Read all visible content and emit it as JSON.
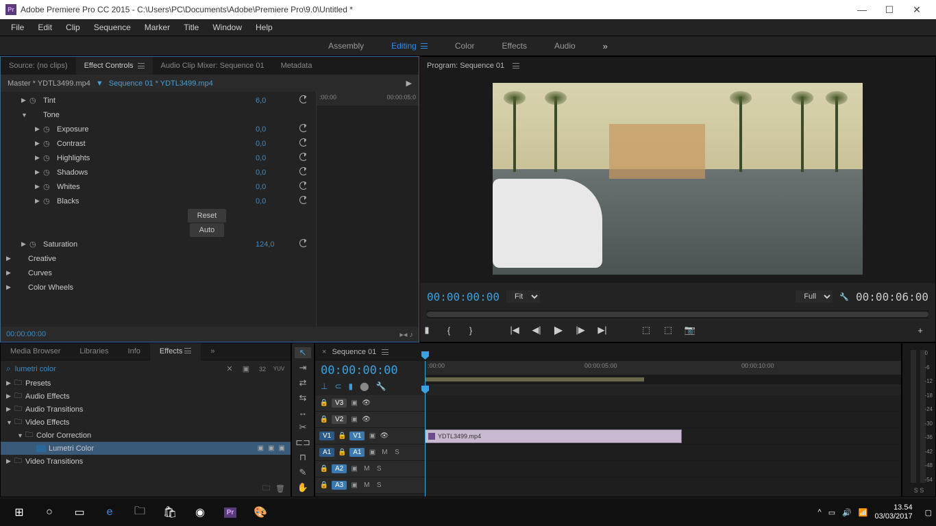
{
  "titlebar": {
    "app": "Pr",
    "title": "Adobe Premiere Pro CC 2015 - C:\\Users\\PC\\Documents\\Adobe\\Premiere Pro\\9.0\\Untitled *"
  },
  "menubar": [
    "File",
    "Edit",
    "Clip",
    "Sequence",
    "Marker",
    "Title",
    "Window",
    "Help"
  ],
  "workspaces": {
    "items": [
      "Assembly",
      "Editing",
      "Color",
      "Effects",
      "Audio"
    ],
    "active": "Editing"
  },
  "source_tabs": {
    "source": "Source: (no clips)",
    "effect_controls": "Effect Controls",
    "audio_mixer": "Audio Clip Mixer: Sequence 01",
    "metadata": "Metadata"
  },
  "effect_controls": {
    "master": "Master * YDTL3499.mp4",
    "seq": "Sequence 01 * YDTL3499.mp4",
    "ruler_start": ":00:00",
    "ruler_end": "00:00:05:0",
    "rows": [
      {
        "indent": 1,
        "arrow": "▶",
        "stop": true,
        "label": "Tint",
        "val": "6,0",
        "reset": true
      },
      {
        "indent": 1,
        "arrow": "▼",
        "stop": false,
        "label": "Tone",
        "val": "",
        "reset": false
      },
      {
        "indent": 2,
        "arrow": "▶",
        "stop": true,
        "label": "Exposure",
        "val": "0,0",
        "reset": true
      },
      {
        "indent": 2,
        "arrow": "▶",
        "stop": true,
        "label": "Contrast",
        "val": "0,0",
        "reset": true
      },
      {
        "indent": 2,
        "arrow": "▶",
        "stop": true,
        "label": "Highlights",
        "val": "0,0",
        "reset": true
      },
      {
        "indent": 2,
        "arrow": "▶",
        "stop": true,
        "label": "Shadows",
        "val": "0,0",
        "reset": true
      },
      {
        "indent": 2,
        "arrow": "▶",
        "stop": true,
        "label": "Whites",
        "val": "0,0",
        "reset": true
      },
      {
        "indent": 2,
        "arrow": "▶",
        "stop": true,
        "label": "Blacks",
        "val": "0,0",
        "reset": true
      }
    ],
    "reset_btn": "Reset",
    "auto_btn": "Auto",
    "saturation": {
      "label": "Saturation",
      "val": "124,0"
    },
    "sections": [
      "Creative",
      "Curves",
      "Color Wheels"
    ],
    "footer_tc": "00:00:00:00"
  },
  "program": {
    "title": "Program: Sequence 01",
    "tc_left": "00:00:00:00",
    "fit": "Fit",
    "full": "Full",
    "tc_right": "00:00:06:00"
  },
  "project_tabs": {
    "items": [
      "Media Browser",
      "Libraries",
      "Info",
      "Effects"
    ],
    "active": "Effects"
  },
  "effects_search": "lumetri color",
  "effects_tree": [
    {
      "indent": 0,
      "arrow": "▶",
      "icon": "folder",
      "label": "Presets"
    },
    {
      "indent": 0,
      "arrow": "▶",
      "icon": "folder",
      "label": "Audio Effects"
    },
    {
      "indent": 0,
      "arrow": "▶",
      "icon": "folder",
      "label": "Audio Transitions"
    },
    {
      "indent": 0,
      "arrow": "▼",
      "icon": "folder",
      "label": "Video Effects"
    },
    {
      "indent": 1,
      "arrow": "▼",
      "icon": "folder",
      "label": "Color Correction"
    },
    {
      "indent": 2,
      "arrow": "",
      "icon": "preset",
      "label": "Lumetri Color",
      "selected": true
    },
    {
      "indent": 0,
      "arrow": "▶",
      "icon": "folder",
      "label": "Video Transitions"
    }
  ],
  "timeline": {
    "seq_name": "Sequence 01",
    "tc": "00:00:00:00",
    "ruler": [
      ":00:00",
      "00:00:05:00",
      "00:00:10:00"
    ],
    "tracks": {
      "v3": "V3",
      "v2": "V2",
      "v1": "V1",
      "a1": "A1",
      "a2": "A2",
      "a3": "A3",
      "v1_src": "V1",
      "a1_src": "A1",
      "m": "M",
      "s": "S"
    },
    "clip_name": "YDTL3499.mp4"
  },
  "meters": {
    "labels": [
      "0",
      "-6",
      "-12",
      "-18",
      "-24",
      "-30",
      "-36",
      "-42",
      "-48",
      "-54"
    ],
    "foot": "S  S"
  },
  "taskbar": {
    "time": "13.54",
    "date": "03/03/2017"
  }
}
